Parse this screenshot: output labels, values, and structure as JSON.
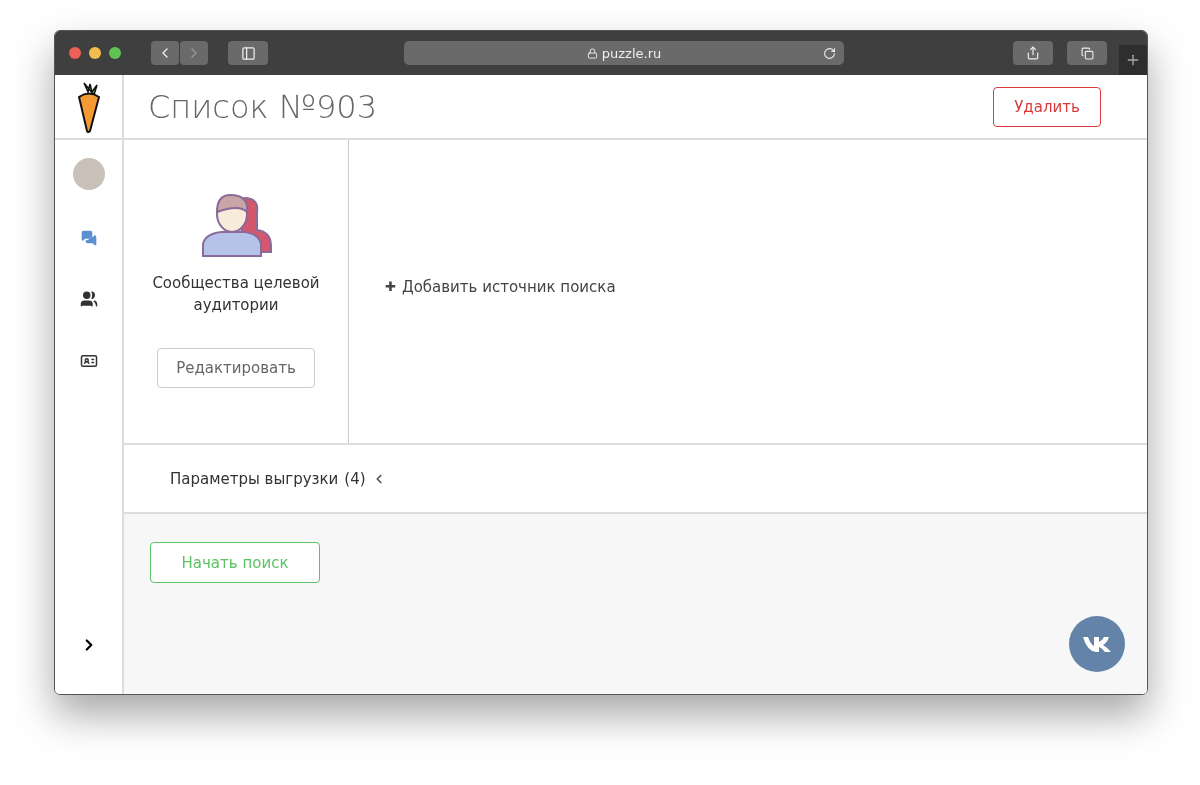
{
  "browser": {
    "url": "puzzle.ru"
  },
  "sidebar": {
    "items": [
      {
        "kind": "chat",
        "selected": true
      },
      {
        "kind": "group",
        "selected": false
      },
      {
        "kind": "card",
        "selected": false
      }
    ]
  },
  "header": {
    "title": "Список №903",
    "delete_button": "Удалить"
  },
  "source": {
    "title": "Сообщества целевой аудитории",
    "edit_button": "Редактировать"
  },
  "add_source": {
    "icon": "✚",
    "label": "Добавить источник поиска"
  },
  "export": {
    "label": "Параметры выгрузки",
    "count": "(4)",
    "expanded": false
  },
  "start_button": "Начать поиск"
}
